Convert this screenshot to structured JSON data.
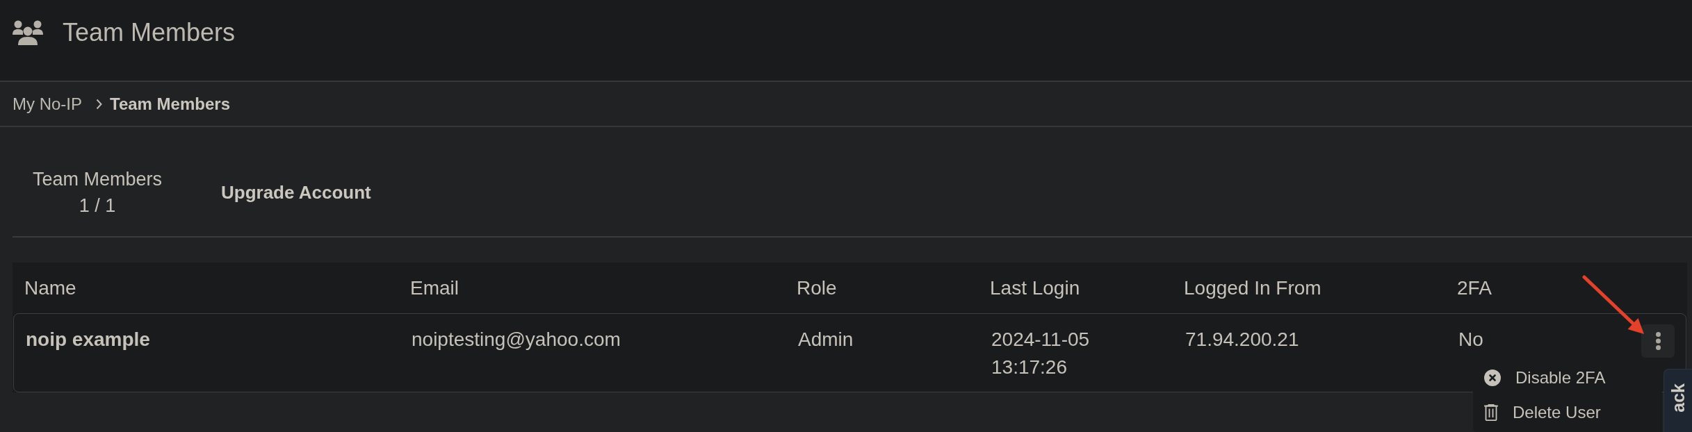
{
  "header": {
    "title": "Team Members"
  },
  "breadcrumb": [
    {
      "label": "My No-IP",
      "current": false
    },
    {
      "label": "Team Members",
      "current": true
    }
  ],
  "summary": {
    "label": "Team Members",
    "count": "1 / 1",
    "upgrade": "Upgrade Account"
  },
  "table": {
    "columns": [
      "Name",
      "Email",
      "Role",
      "Last Login",
      "Logged In From",
      "2FA"
    ],
    "rows": [
      {
        "name": "noip example",
        "email": "noiptesting@yahoo.com",
        "role": "Admin",
        "last_login": "2024-11-05 13:17:26",
        "logged_in_from": "71.94.200.21",
        "two_fa": "No",
        "menu": {
          "open": true,
          "items": [
            {
              "kind": "disable",
              "label": "Disable 2FA"
            },
            {
              "kind": "delete",
              "label": "Delete User"
            }
          ]
        }
      }
    ]
  },
  "feedback_tab": {
    "label": "ack"
  }
}
